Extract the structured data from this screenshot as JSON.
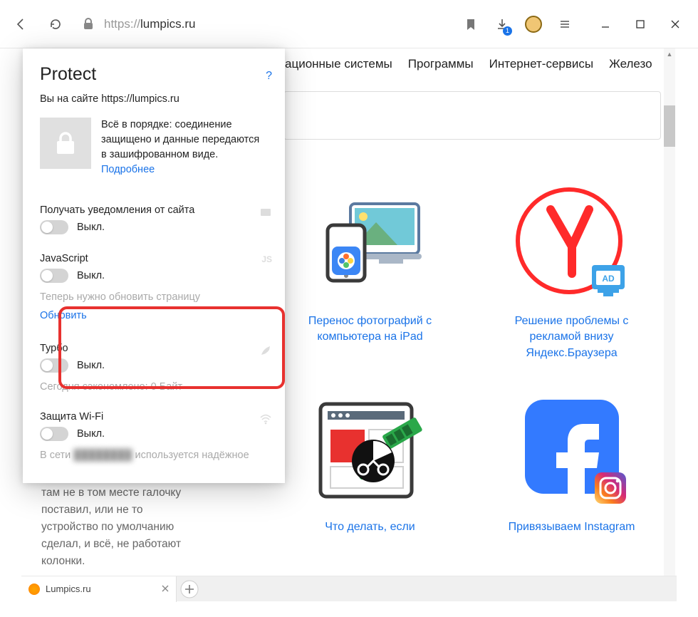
{
  "chrome": {
    "url_proto": "https://",
    "url_host": "lumpics.ru",
    "dl_count": "1"
  },
  "nav": {
    "os": "ационные системы",
    "programs": "Программы",
    "services": "Интернет-сервисы",
    "hardware": "Железо"
  },
  "popup": {
    "title": "Protect",
    "help": "?",
    "subtitle": "Вы на сайте https://lumpics.ru",
    "secure_l1": "Всё в порядке: соединение",
    "secure_l2": "защищено и данные передаются",
    "secure_l3": "в зашифрованном виде.",
    "more": "Подробнее",
    "notif_title": "Получать уведомления от сайта",
    "off": "Выкл.",
    "js_title": "JavaScript",
    "js_hint": "Теперь нужно обновить страницу",
    "js_refresh": "Обновить",
    "turbo_title": "Турбо",
    "turbo_saved": "Сегодня сэкономлено: 0 Байт",
    "wifi_title": "Защита Wi-Fi",
    "wifi_l1a": "В сети ",
    "wifi_l1b": "используется надёжное"
  },
  "comment": {
    "l1": "там не в том месте галочку",
    "l2": "поставил, или не то",
    "l3": "устройство по умолчанию",
    "l4": "сделал, и всё, не работают",
    "l5": "колонки."
  },
  "cards": {
    "c1": "Перенос фотографий с компьютера на iPad",
    "c2": "Решение проблемы с рекламой внизу Яндекс.Браузера",
    "c3": "Что делать, если",
    "c4": "Привязываем Instagram"
  },
  "tab": {
    "title": "Lumpics.ru"
  }
}
